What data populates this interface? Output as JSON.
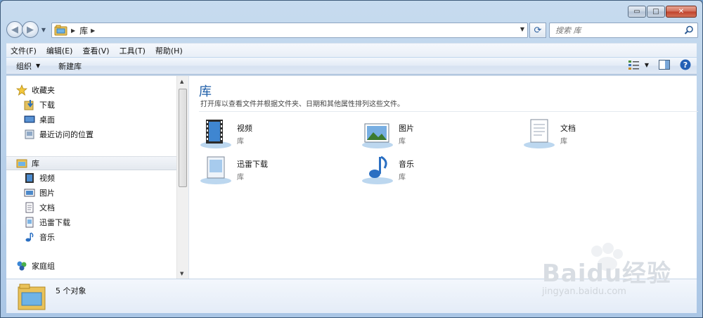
{
  "window": {
    "caption_buttons": {
      "minimize": "▭",
      "maximize": "□",
      "close": "✕"
    }
  },
  "address_bar": {
    "crumbs": [
      "库"
    ],
    "refresh_icon": "refresh-icon"
  },
  "search": {
    "placeholder": "搜索 库"
  },
  "menu": [
    "文件(F)",
    "编辑(E)",
    "查看(V)",
    "工具(T)",
    "帮助(H)"
  ],
  "command_bar": {
    "organize": "组织",
    "new_library": "新建库"
  },
  "nav_pane": {
    "favorites": {
      "label": "收藏夹",
      "items": [
        "下载",
        "桌面",
        "最近访问的位置"
      ]
    },
    "libraries": {
      "label": "库",
      "items": [
        "视频",
        "图片",
        "文档",
        "迅雷下载",
        "音乐"
      ]
    },
    "homegroup": {
      "label": "家庭组"
    }
  },
  "main": {
    "title": "库",
    "description": "打开库以查看文件并根据文件夹、日期和其他属性排列这些文件。",
    "tiles": [
      {
        "name": "视频",
        "type": "库",
        "icon": "video-library-icon"
      },
      {
        "name": "图片",
        "type": "库",
        "icon": "pictures-library-icon"
      },
      {
        "name": "文档",
        "type": "库",
        "icon": "documents-library-icon"
      },
      {
        "name": "迅雷下载",
        "type": "库",
        "icon": "download-library-icon"
      },
      {
        "name": "音乐",
        "type": "库",
        "icon": "music-library-icon"
      }
    ]
  },
  "details": {
    "count": "5 个对象"
  },
  "watermark": {
    "brand": "Baidu经验",
    "url": "jingyan.baidu.com"
  },
  "colors": {
    "accent": "#1e5ea8",
    "chrome": "#b9d1ea"
  }
}
